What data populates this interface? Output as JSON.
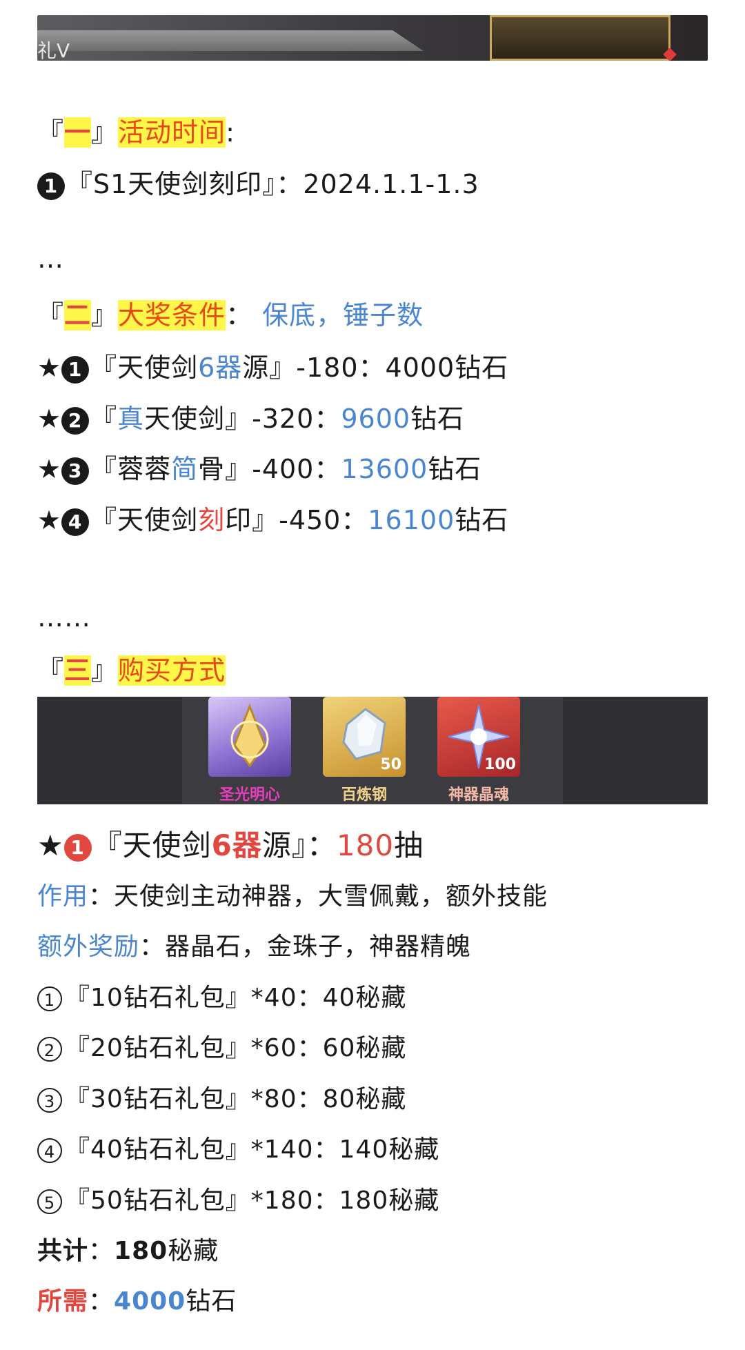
{
  "banner": {
    "tag": "礼V"
  },
  "section1": {
    "left_bracket": "『",
    "num": "一",
    "right_bracket": "』",
    "title": "活动时间",
    "colon": ":",
    "item_marker": "1",
    "item_text": "『S1天使剑刻印』：2024.1.1-1.3"
  },
  "ellipsis1": "…",
  "section2": {
    "left_bracket": "『",
    "num": "二",
    "right_bracket": "』",
    "title": "大奖条件",
    "colon": "：",
    "note": "保底，锤子数",
    "rows": [
      {
        "star": "★",
        "marker": "1",
        "pre": "『天使剑",
        "hl": "6器",
        "post": "源』-180：4000钻石",
        "hl_color": "blue"
      },
      {
        "star": "★",
        "marker": "2",
        "pre": "『",
        "hl": "真",
        "mid": "天使剑』-320：",
        "num": "9600",
        "post": "钻石"
      },
      {
        "star": "★",
        "marker": "3",
        "pre": "『蓉蓉",
        "hl": "简",
        "mid": "骨』-400：",
        "num": "13600",
        "post": "钻石"
      },
      {
        "star": "★",
        "marker": "4",
        "pre": "『天使剑",
        "hl": "刻",
        "mid": "印』-450：",
        "num": "16100",
        "post": "钻石"
      }
    ]
  },
  "ellipsis2": "……",
  "section3": {
    "left_bracket": "『",
    "num": "三",
    "right_bracket": "』",
    "title": "购买方式"
  },
  "items": [
    {
      "name": "圣光明心",
      "count": "",
      "icon": "angel-emblem-icon"
    },
    {
      "name": "百炼钢",
      "count": "50",
      "icon": "steel-crystal-icon"
    },
    {
      "name": "神器晶魂",
      "count": "100",
      "icon": "artifact-soul-icon"
    }
  ],
  "detail": {
    "star": "★",
    "marker": "1",
    "pre": "『天使剑",
    "hl": "6器",
    "mid": "源』：",
    "num": "180",
    "post": "抽",
    "effect_label": "作用",
    "effect_text": "：天使剑主动神器，大雪佩戴，额外技能",
    "bonus_label": "额外奖励",
    "bonus_text": "：器晶石，金珠子，神器精魄",
    "packs": [
      {
        "marker": "1",
        "text": "『10钻石礼包』*40：40秘藏"
      },
      {
        "marker": "2",
        "text": "『20钻石礼包』*60：60秘藏"
      },
      {
        "marker": "3",
        "text": "『30钻石礼包』*80：80秘藏"
      },
      {
        "marker": "4",
        "text": "『40钻石礼包』*140：140秘藏"
      },
      {
        "marker": "5",
        "text": "『50钻石礼包』*180：180秘藏"
      }
    ],
    "total_label": "共计",
    "total_sep": "：",
    "total_num": "180",
    "total_unit": "秘藏",
    "need_label": "所需",
    "need_sep": "：",
    "need_num": "4000",
    "need_unit": "钻石"
  },
  "colors": {
    "highlight": "#fff64a",
    "red": "#e0473e",
    "blue": "#4a86cf"
  }
}
